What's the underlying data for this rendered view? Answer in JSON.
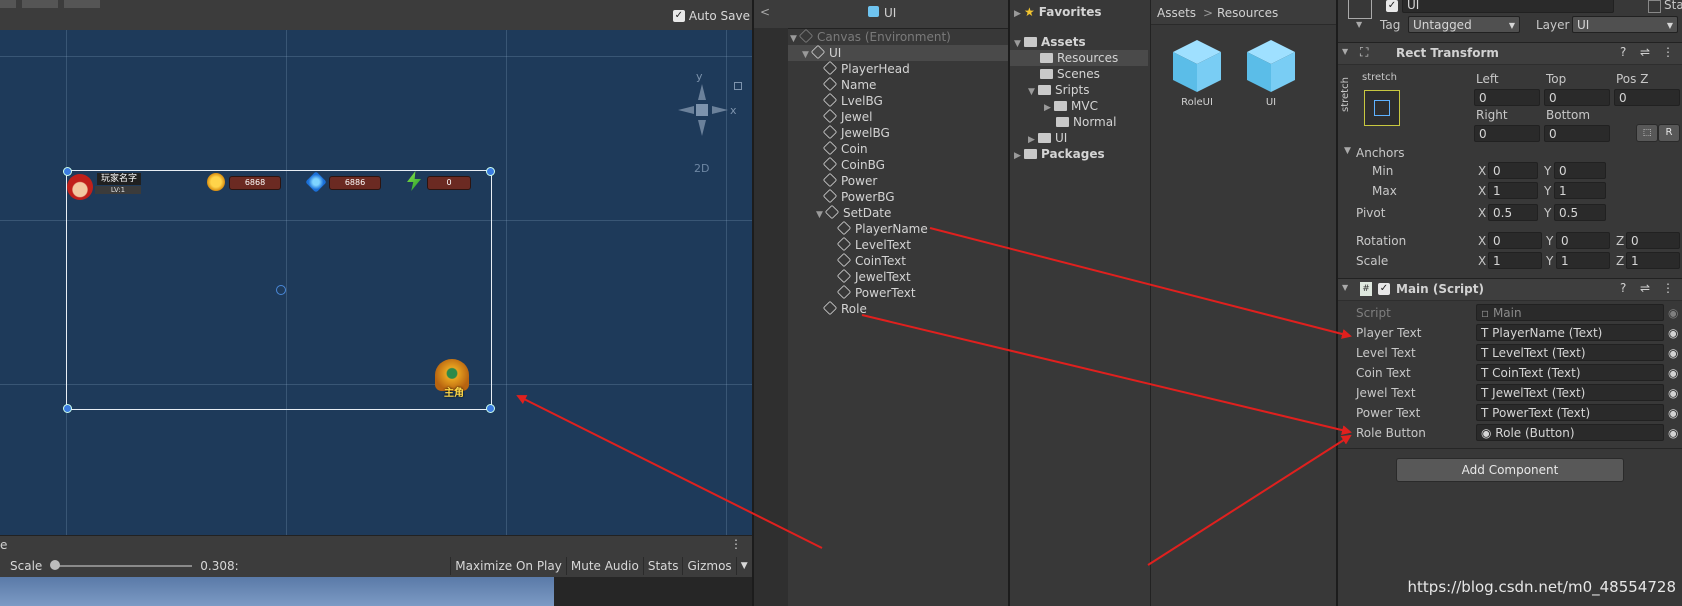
{
  "scene": {
    "auto_save": "Auto Save",
    "hud": {
      "player_name": "玩家名字",
      "level": "LV:1",
      "coin": "6868",
      "jewel": "6886",
      "power": "0",
      "role_label": "主角"
    },
    "gizmo": {
      "y": "y",
      "x": "x",
      "mode": "2D"
    }
  },
  "game": {
    "tab": "e",
    "scale_label": "Scale",
    "scale_value": "0.308:",
    "maximize": "Maximize On Play",
    "mute": "Mute Audio",
    "stats": "Stats",
    "gizmos": "Gizmos"
  },
  "hierarchy": {
    "title": "UI",
    "back": "<",
    "items": [
      {
        "label": "Canvas (Environment)"
      },
      {
        "label": "UI"
      },
      {
        "label": "PlayerHead"
      },
      {
        "label": "Name"
      },
      {
        "label": "LvelBG"
      },
      {
        "label": "Jewel"
      },
      {
        "label": "JewelBG"
      },
      {
        "label": "Coin"
      },
      {
        "label": "CoinBG"
      },
      {
        "label": "Power"
      },
      {
        "label": "PowerBG"
      },
      {
        "label": "SetDate"
      },
      {
        "label": "PlayerName"
      },
      {
        "label": "LevelText"
      },
      {
        "label": "CoinText"
      },
      {
        "label": "JewelText"
      },
      {
        "label": "PowerText"
      },
      {
        "label": "Role"
      }
    ]
  },
  "project": {
    "tree": [
      {
        "label": "Favorites"
      },
      {
        "label": "Assets"
      },
      {
        "label": "Resources"
      },
      {
        "label": "Scenes"
      },
      {
        "label": "Sripts"
      },
      {
        "label": "MVC"
      },
      {
        "label": "Normal"
      },
      {
        "label": "UI"
      },
      {
        "label": "Packages"
      }
    ],
    "breadcrumb": {
      "root": "Assets",
      "sep": ">",
      "current": "Resources"
    },
    "assets": [
      {
        "label": "RoleUI"
      },
      {
        "label": "UI"
      }
    ]
  },
  "inspector": {
    "name": "UI",
    "static": "Static",
    "tag_label": "Tag",
    "tag_value": "Untagged",
    "layer_label": "Layer",
    "layer_value": "UI",
    "rect_transform": {
      "title": "Rect Transform",
      "stretch_h": "stretch",
      "stretch_v": "stretch",
      "left_label": "Left",
      "left": "0",
      "top_label": "Top",
      "top": "0",
      "posz_label": "Pos Z",
      "posz": "0",
      "right_label": "Right",
      "right": "0",
      "bottom_label": "Bottom",
      "bottom": "0",
      "r_button": "R",
      "anchors": "Anchors",
      "min": "Min",
      "min_x": "0",
      "min_y": "0",
      "max": "Max",
      "max_x": "1",
      "max_y": "1",
      "pivot": "Pivot",
      "pivot_x": "0.5",
      "pivot_y": "0.5",
      "rotation": "Rotation",
      "rot_x": "0",
      "rot_y": "0",
      "rot_z": "0",
      "scale": "Scale",
      "scale_x": "1",
      "scale_y": "1",
      "scale_z": "1",
      "x": "X",
      "y": "Y",
      "z": "Z"
    },
    "main_script": {
      "title": "Main (Script)",
      "fields": [
        {
          "label": "Script",
          "value": "Main"
        },
        {
          "label": "Player Text",
          "value": "PlayerName (Text)"
        },
        {
          "label": "Level Text",
          "value": "LevelText (Text)"
        },
        {
          "label": "Coin Text",
          "value": "CoinText (Text)"
        },
        {
          "label": "Jewel Text",
          "value": "JewelText (Text)"
        },
        {
          "label": "Power Text",
          "value": "PowerText (Text)"
        },
        {
          "label": "Role Button",
          "value": "Role (Button)"
        }
      ]
    },
    "add_component": "Add Component"
  },
  "watermark": "https://blog.csdn.net/m0_48554728",
  "colors": {
    "arrow": "#e0201e",
    "accent": "#3b7be0",
    "selection": "#4a4a4a"
  }
}
